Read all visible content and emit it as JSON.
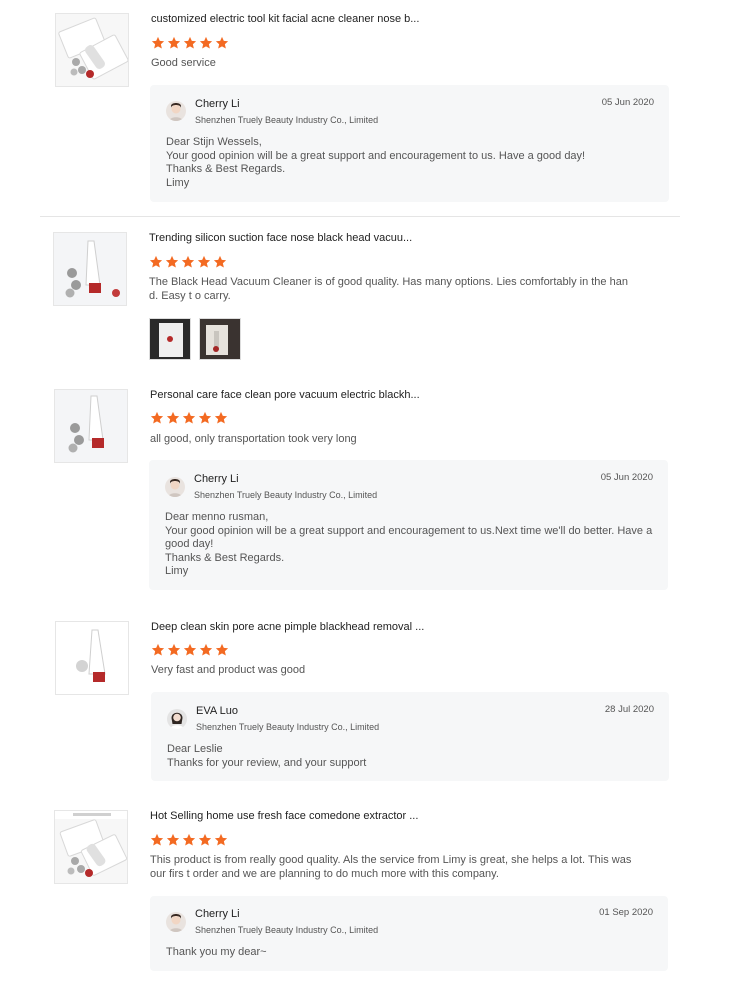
{
  "colors": {
    "star": "#f36a22",
    "reply_bg": "#f6f7f8"
  },
  "reviews": [
    {
      "product_icon": "product-kit-icon",
      "title": "customized electric tool kit facial acne cleaner nose b...",
      "rating": 5,
      "text": "Good service",
      "reply": {
        "name": "Cherry Li",
        "company": "Shenzhen Truely Beauty Industry Co., Limited",
        "date": "05 Jun 2020",
        "lines": [
          "Dear Stijn Wessels,",
          "Your good opinion will be a great support and encouragement to us. Have a good day!",
          "Thanks & Best Regards.",
          "Limy"
        ]
      }
    },
    {
      "product_icon": "product-device-icon",
      "title": "Trending silicon suction face nose black head vacuu...",
      "rating": 5,
      "text": "The Black Head Vacuum Cleaner is of good quality. Has many options. Lies comfortably in the hand. Easy t o carry."
    },
    {
      "product_icon": "product-device-icon",
      "title": "Personal care face clean pore vacuum electric blackh...",
      "rating": 5,
      "text": "all good, only transportation took very long",
      "reply": {
        "name": "Cherry Li",
        "company": "Shenzhen Truely Beauty Industry Co., Limited",
        "date": "05 Jun 2020",
        "lines": [
          "Dear menno rusman,",
          "Your good opinion will be a great support and encouragement to us.Next time we'll do better. Have a good day!",
          "Thanks & Best Regards.",
          "Limy"
        ]
      }
    },
    {
      "product_icon": "product-device-icon",
      "title": "Deep clean skin pore acne pimple blackhead removal ...",
      "rating": 5,
      "text": "Very fast and product was good",
      "reply": {
        "name": "EVA Luo",
        "company": "Shenzhen Truely Beauty Industry Co., Limited",
        "date": "28 Jul 2020",
        "lines": [
          "Dear Leslie",
          "Thanks for your review, and your support"
        ]
      }
    },
    {
      "product_icon": "product-kit-icon",
      "title": "Hot Selling home use fresh face comedone extractor ...",
      "rating": 5,
      "text": "This product is from really good quality. Als the service from Limy is great, she helps a lot. This was our firs t order and we are planning to do much more with this company.",
      "reply": {
        "name": "Cherry Li",
        "company": "Shenzhen Truely Beauty Industry Co., Limited",
        "date": "01 Sep 2020",
        "lines": [
          "Thank you my dear~"
        ]
      }
    }
  ]
}
